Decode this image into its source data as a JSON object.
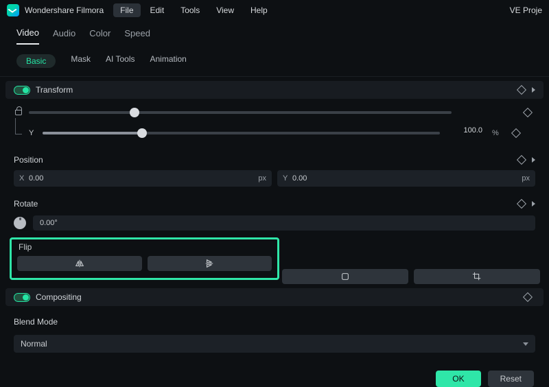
{
  "titlebar": {
    "app_name": "Wondershare Filmora",
    "menu": {
      "file": "File",
      "edit": "Edit",
      "tools": "Tools",
      "view": "View",
      "help": "Help"
    },
    "project": "VE Proje"
  },
  "tabs": {
    "video": "Video",
    "audio": "Audio",
    "color": "Color",
    "speed": "Speed"
  },
  "subtabs": {
    "basic": "Basic",
    "mask": "Mask",
    "aitools": "AI Tools",
    "animation": "Animation"
  },
  "transform": {
    "title": "Transform",
    "y_label": "Y",
    "y_value": "100.0",
    "y_unit": "%"
  },
  "position": {
    "title": "Position",
    "x_label": "X",
    "x_value": "0.00",
    "x_unit": "px",
    "y_label": "Y",
    "y_value": "0.00",
    "y_unit": "px"
  },
  "rotate": {
    "title": "Rotate",
    "value": "0.00°"
  },
  "flip": {
    "title": "Flip"
  },
  "compositing": {
    "title": "Compositing"
  },
  "blend": {
    "title": "Blend Mode",
    "value": "Normal"
  },
  "buttons": {
    "ok": "OK",
    "reset": "Reset"
  }
}
